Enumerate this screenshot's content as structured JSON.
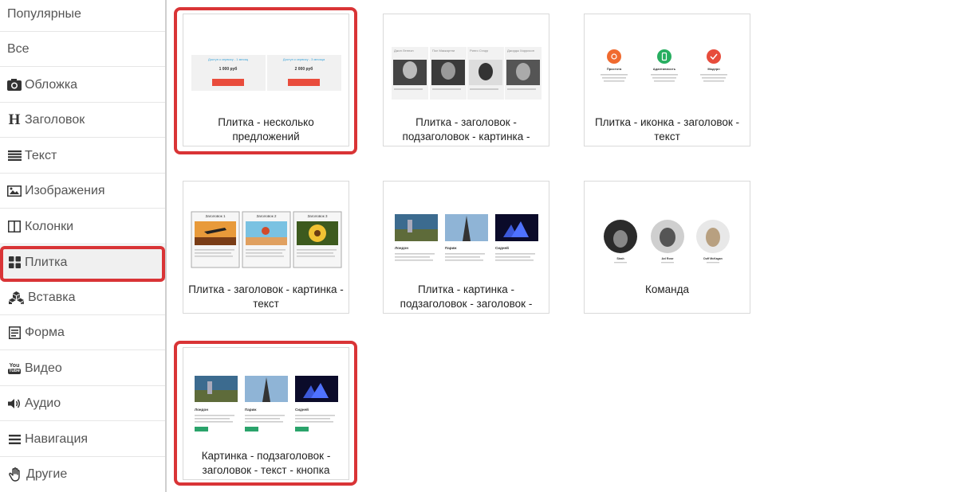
{
  "sidebar": {
    "items": [
      {
        "label": "Популярные",
        "icon": "none"
      },
      {
        "label": "Все",
        "icon": "none"
      },
      {
        "label": "Обложка",
        "icon": "camera-icon"
      },
      {
        "label": "Заголовок",
        "icon": "heading-icon"
      },
      {
        "label": "Текст",
        "icon": "text-lines-icon"
      },
      {
        "label": "Изображения",
        "icon": "image-icon"
      },
      {
        "label": "Колонки",
        "icon": "columns-icon"
      },
      {
        "label": "Плитка",
        "icon": "tiles-icon"
      },
      {
        "label": "Вставка",
        "icon": "cubes-icon"
      },
      {
        "label": "Форма",
        "icon": "form-icon"
      },
      {
        "label": "Видео",
        "icon": "youtube-icon"
      },
      {
        "label": "Аудио",
        "icon": "speaker-icon"
      },
      {
        "label": "Навигация",
        "icon": "menu-icon"
      },
      {
        "label": "Другие",
        "icon": "hand-icon"
      }
    ],
    "active_index": 7
  },
  "cards": [
    {
      "label": "Плитка - несколько предложений",
      "thumb": {
        "plan1_title": "Доступ к сервису - 1 месяц",
        "plan1_price": "1 000 руб",
        "plan2_title": "Доступ к сервису - 3 месяца",
        "plan2_price": "2 000 руб"
      }
    },
    {
      "label": "Плитка - заголовок - подзаголовок - картинка -",
      "thumb": {
        "names": [
          "Джон Леннон",
          "Пол Маккартни",
          "Ринго Старр",
          "Джордж Харрисон"
        ]
      }
    },
    {
      "label": "Плитка - иконка - заголовок - текст",
      "thumb": {
        "titles": [
          "Простота",
          "Адаптивность",
          "Модерн"
        ]
      }
    },
    {
      "label": "Плитка - заголовок - картинка - текст",
      "thumb": {
        "titles": [
          "Заголовок 1",
          "Заголовок 2",
          "Заголовок 3"
        ]
      }
    },
    {
      "label": "Плитка - картинка - подзаголовок - заголовок -",
      "thumb": {
        "cities": [
          "Лондон",
          "Париж",
          "Сидней"
        ]
      }
    },
    {
      "label": "Команда",
      "thumb": {
        "names": [
          "Slash",
          "Axl Rose",
          "Duff McKagan"
        ]
      }
    },
    {
      "label": "Картинка - подзаголовок - заголовок - текст - кнопка",
      "thumb": {
        "cities": [
          "Лондон",
          "Париж",
          "Сидней"
        ]
      }
    }
  ],
  "colors": {
    "highlight": "#d93436",
    "price_button": "#e94c3c",
    "cta_button": "#2aa36b",
    "icon_orange": "#f06a2f",
    "icon_green": "#27ae60",
    "icon_red": "#e74c3c"
  }
}
